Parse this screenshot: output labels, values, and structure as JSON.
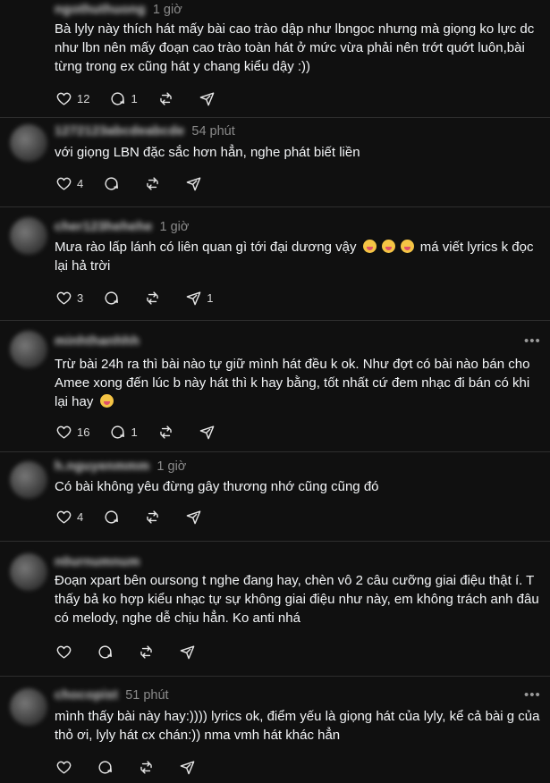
{
  "posts": [
    {
      "username": "ngothuthuong",
      "time": "1 giờ",
      "text": "Bà lyly này thích hát mấy bài cao trào dập như lbngoc nhưng mà giọng ko lực dc như lbn nên mấy đoạn cao trào toàn hát ở mức vừa phải nên trớt quớt luôn,bài từng trong ex cũng hát y chang kiểu dậy :))",
      "likes": "12",
      "replies": "1",
      "reposts": "",
      "shares": ""
    },
    {
      "username": "1272123abcdeabcde",
      "time": "54 phút",
      "text": "với giọng LBN đặc sắc hơn hẳn, nghe phát biết liền",
      "likes": "4",
      "replies": "",
      "reposts": "",
      "shares": ""
    },
    {
      "username": "cher123hehehe",
      "time": "1 giờ",
      "text_before": "Mưa rào lấp lánh có liên quan gì tới đại dương vậy",
      "text_after": "má viết lyrics k đọc lại hả trời",
      "likes": "3",
      "replies": "",
      "reposts": "",
      "shares": "1"
    },
    {
      "username": "minhthanhhh",
      "time": "",
      "text": "Trừ bài 24h ra thì bài nào tự giữ mình hát đều k ok. Như đợt có bài nào bán cho Amee xong đến lúc b này hát thì k hay bằng, tốt nhất cứ đem nhạc đi bán có khi lại hay",
      "likes": "16",
      "replies": "1",
      "reposts": "",
      "shares": ""
    },
    {
      "username": "h.nguyenmmm",
      "time": "1 giờ",
      "text": "Có bài không yêu đừng gây thương nhớ cũng cũng đó",
      "likes": "4",
      "replies": "",
      "reposts": "",
      "shares": ""
    },
    {
      "username": "n0urnumnum",
      "time": "",
      "text": "Đoạn xpart bên oursong t nghe đang hay, chèn vô 2 câu cưỡng giai điệu thật í. T thấy bả ko hợp kiểu nhạc tự sự không giai điệu như này, em không trách anh đâu có melody, nghe dễ chịu hẳn. Ko anti nhá",
      "likes": "",
      "replies": "",
      "reposts": "",
      "shares": ""
    },
    {
      "username": "chocopist",
      "time": "51 phút",
      "text": "mình thấy bài này hay:)))) lyrics ok, điểm yếu là giọng hát của lyly, kể cả bài g của thỏ ơi, lyly hát cx chán:)) nma vmh hát khác hẳn",
      "likes": "",
      "replies": "",
      "reposts": "",
      "shares": ""
    }
  ],
  "icons": {
    "like": "heart-icon",
    "reply": "comment-icon",
    "repost": "repost-icon",
    "share": "send-icon",
    "more": "more-icon"
  },
  "colors": {
    "background": "#101010",
    "text": "#f3f5f7",
    "muted": "#8a8a8a",
    "divider": "#2e2e2e"
  }
}
